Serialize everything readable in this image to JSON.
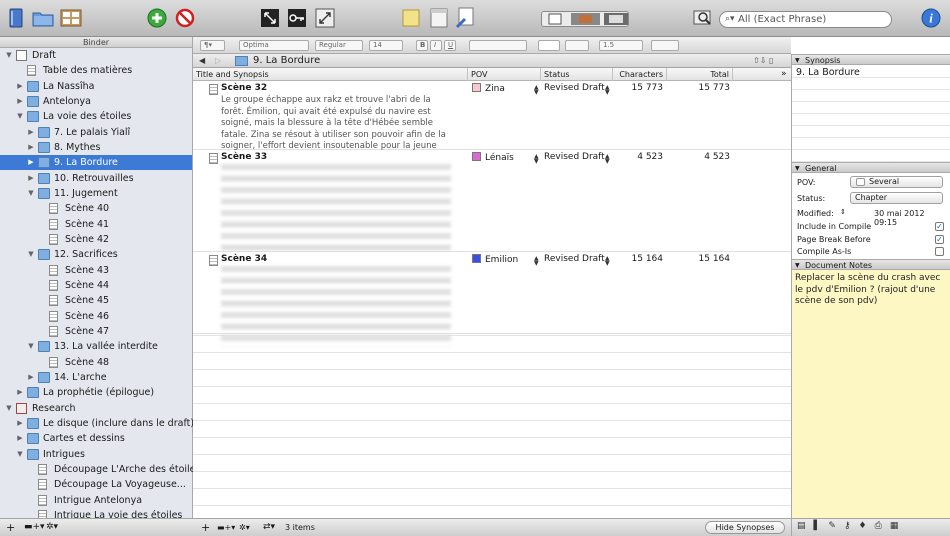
{
  "toolbar": {
    "search_placeholder": "All (Exact Phrase)",
    "icons": [
      "binder-icon",
      "collections-icon",
      "corkboard-view-icon",
      "add-icon",
      "delete-icon",
      "full-screen-icon",
      "keywords-icon",
      "quick-reference-icon",
      "snapshot-icon",
      "scratchpad-icon",
      "format-icon",
      "split-editor-icon",
      "search-icon",
      "info-icon"
    ]
  },
  "binder": {
    "title": "Binder",
    "items": [
      {
        "label": "Draft",
        "depth": 0,
        "icon": "draft",
        "expanded": true
      },
      {
        "label": "Table des matières",
        "depth": 1,
        "icon": "doc"
      },
      {
        "label": "La Nassîha",
        "depth": 1,
        "icon": "folder",
        "collapsed": true
      },
      {
        "label": "Antelonya",
        "depth": 1,
        "icon": "folder",
        "collapsed": true
      },
      {
        "label": "La voie des étoiles",
        "depth": 1,
        "icon": "folder",
        "expanded": true
      },
      {
        "label": "7. Le palais Yialî",
        "depth": 2,
        "icon": "folder",
        "collapsed": true
      },
      {
        "label": "8. Mythes",
        "depth": 2,
        "icon": "folder",
        "collapsed": true
      },
      {
        "label": "9. La Bordure",
        "depth": 2,
        "icon": "folder",
        "collapsed": true,
        "selected": true
      },
      {
        "label": "10. Retrouvailles",
        "depth": 2,
        "icon": "folder",
        "collapsed": true
      },
      {
        "label": "11. Jugement",
        "depth": 2,
        "icon": "folder",
        "expanded": true
      },
      {
        "label": "Scène 40",
        "depth": 3,
        "icon": "doc"
      },
      {
        "label": "Scène 41",
        "depth": 3,
        "icon": "doc"
      },
      {
        "label": "Scène 42",
        "depth": 3,
        "icon": "doc"
      },
      {
        "label": "12. Sacrifices",
        "depth": 2,
        "icon": "folder",
        "expanded": true
      },
      {
        "label": "Scène 43",
        "depth": 3,
        "icon": "doc"
      },
      {
        "label": "Scène 44",
        "depth": 3,
        "icon": "doc"
      },
      {
        "label": "Scène 45",
        "depth": 3,
        "icon": "doc"
      },
      {
        "label": "Scène 46",
        "depth": 3,
        "icon": "doc"
      },
      {
        "label": "Scène 47",
        "depth": 3,
        "icon": "doc"
      },
      {
        "label": "13. La vallée interdite",
        "depth": 2,
        "icon": "folder",
        "expanded": true
      },
      {
        "label": "Scène 48",
        "depth": 3,
        "icon": "doc"
      },
      {
        "label": "14. L'arche",
        "depth": 2,
        "icon": "folder",
        "collapsed": true
      },
      {
        "label": "La prophétie (épilogue)",
        "depth": 1,
        "icon": "folder",
        "collapsed": true
      },
      {
        "label": "Research",
        "depth": 0,
        "icon": "research",
        "expanded": true
      },
      {
        "label": "Le disque (inclure dans le draft)",
        "depth": 1,
        "icon": "folder",
        "collapsed": true
      },
      {
        "label": "Cartes et dessins",
        "depth": 1,
        "icon": "folder",
        "collapsed": true
      },
      {
        "label": "Intrigues",
        "depth": 1,
        "icon": "folder",
        "expanded": true
      },
      {
        "label": "Découpage L'Arche des étoiles",
        "depth": 2,
        "icon": "doc"
      },
      {
        "label": "Découpage La Voyageuse...",
        "depth": 2,
        "icon": "doc"
      },
      {
        "label": "Intrigue Antelonya",
        "depth": 2,
        "icon": "doc"
      },
      {
        "label": "Intrigue La voie des étoiles",
        "depth": 2,
        "icon": "doc"
      }
    ]
  },
  "format": {
    "style": "¶",
    "font": "Optima",
    "weight": "Regular",
    "size": "14",
    "bold": "B",
    "italic": "I",
    "underline": "U",
    "spacing": "1.5"
  },
  "editor": {
    "header_title": "9. La Bordure",
    "columns": {
      "title": "Title and Synopsis",
      "pov": "POV",
      "status": "Status",
      "characters": "Characters",
      "total": "Total Characters"
    },
    "rows": [
      {
        "title": "Scène 32",
        "synopsis": "Le groupe échappe aux rakz et trouve l'abri de la forêt. Émilion, qui avait été expulsé du navire est soigné, mais la blessure à la tête d'Hébée semble fatale. Zina se résout à utiliser son pouvoir afin de la soigner, l'effort devient insoutenable pour la jeune fille.",
        "pov": "Zina",
        "pov_color": "#f6c8d4",
        "status": "Revised Draft",
        "characters": "15 773",
        "total": "15 773"
      },
      {
        "title": "Scène 33",
        "synopsis": "",
        "pov": "Lénaïs",
        "pov_color": "#d86ad2",
        "status": "Revised Draft",
        "characters": "4 523",
        "total": "4 523"
      },
      {
        "title": "Scène 34",
        "synopsis": "",
        "pov": "Emilion",
        "pov_color": "#3b4fe0",
        "status": "Revised Draft",
        "characters": "15 164",
        "total": "15 164"
      }
    ],
    "footer_count": "3 items",
    "hide_synopses": "Hide Synopses"
  },
  "inspector": {
    "synopsis_title": "Synopsis",
    "synopsis_text": "9. La Bordure",
    "general_title": "General",
    "pov_label": "POV:",
    "pov_value": "Several",
    "status_label": "Status:",
    "status_value": "Chapter",
    "modified_label": "Modified:",
    "modified_value": "30 mai 2012 09:15",
    "include_compile": "Include in Compile",
    "page_break": "Page Break Before",
    "compile_asis": "Compile As-Is",
    "notes_title": "Document Notes",
    "notes_text": "Replacer la scène du crash avec le pdv d'Emilion ? (rajout d'une scène de son pdv)"
  }
}
